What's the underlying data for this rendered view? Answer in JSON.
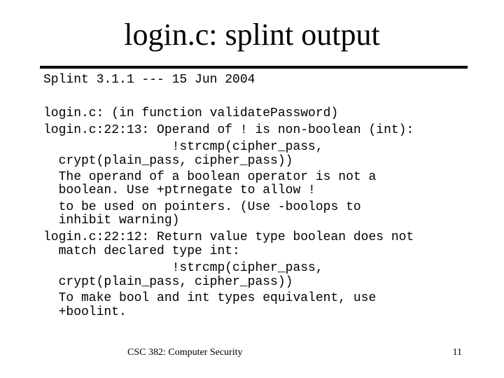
{
  "slide": {
    "title": "login.c: splint output",
    "footer": {
      "course": "CSC 382: Computer Security",
      "page_number": "11"
    }
  },
  "output": {
    "version_line": "Splint 3.1.1 --- 15 Jun 2004",
    "lines": [
      "login.c: (in function validatePassword)",
      "login.c:22:13: Operand of ! is non-boolean (int):",
      "                 !strcmp(cipher_pass,",
      "  crypt(plain_pass, cipher_pass))",
      "  The operand of a boolean operator is not a",
      "  boolean. Use +ptrnegate to allow !",
      "  to be used on pointers. (Use -boolops to",
      "  inhibit warning)",
      "login.c:22:12: Return value type boolean does not",
      "  match declared type int:",
      "                 !strcmp(cipher_pass,",
      "  crypt(plain_pass, cipher_pass))",
      "  To make bool and int types equivalent, use",
      "  +boolint."
    ]
  }
}
